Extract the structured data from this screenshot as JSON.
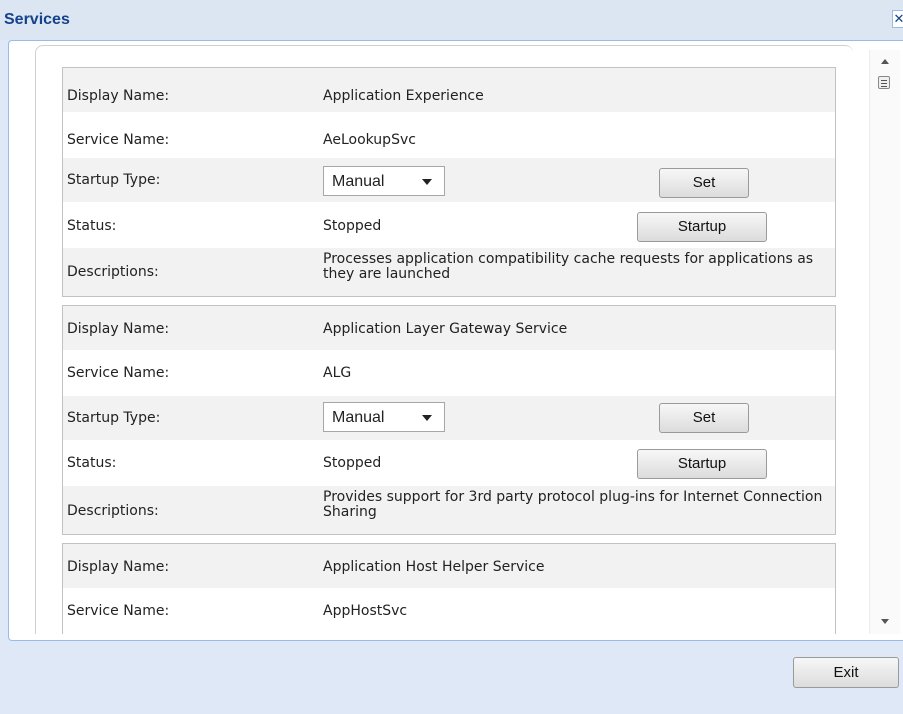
{
  "window": {
    "title": "Services",
    "close_glyph": "✕"
  },
  "labels": {
    "display_name": "Display Name:",
    "service_name": "Service Name:",
    "startup_type": "Startup Type:",
    "status": "Status:",
    "descriptions": "Descriptions:"
  },
  "buttons": {
    "set": "Set",
    "startup": "Startup",
    "exit": "Exit"
  },
  "services": [
    {
      "display_name": "Application Experience",
      "service_name": "AeLookupSvc",
      "startup_type": "Manual",
      "status": "Stopped",
      "description": "Processes application compatibility cache requests for applications as they are launched"
    },
    {
      "display_name": "Application Layer Gateway Service",
      "service_name": "ALG",
      "startup_type": "Manual",
      "status": "Stopped",
      "description": "Provides support for 3rd party protocol plug-ins for Internet Connection Sharing"
    },
    {
      "display_name": "Application Host Helper Service",
      "service_name": "AppHostSvc"
    }
  ],
  "icons": {
    "scroll_up": "scroll-up-arrow-icon",
    "scroll_down": "scroll-down-arrow-icon",
    "dropdown": "chevron-down-icon"
  }
}
